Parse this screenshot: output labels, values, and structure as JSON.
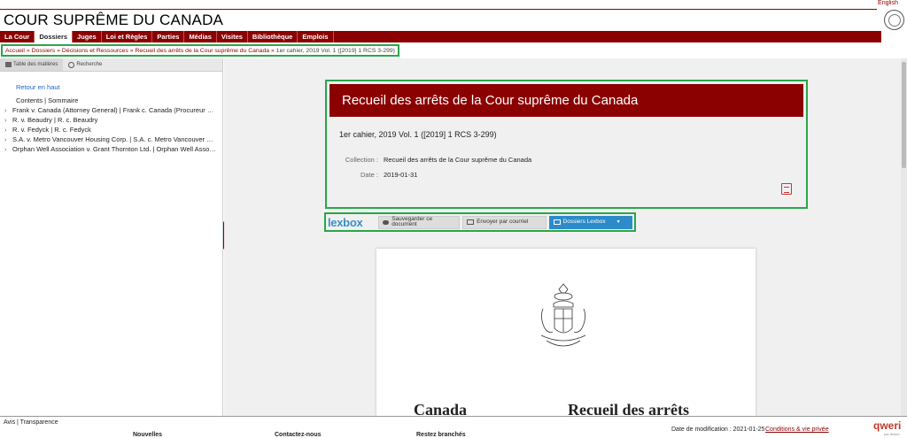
{
  "header": {
    "language_link": "English",
    "site_title": "COUR SUPRÊME DU CANADA"
  },
  "nav": {
    "items": [
      "La Cour",
      "Dossiers",
      "Juges",
      "Loi et Règles",
      "Parties",
      "Médias",
      "Visites",
      "Bibliothèque",
      "Emplois"
    ],
    "active": "Dossiers"
  },
  "breadcrumb": {
    "items": [
      "Accueil",
      "Dossiers",
      "Décisions et Ressources",
      "Recueil des arrêts de la Cour suprême du Canada"
    ],
    "current": "1er cahier, 2019 Vol. 1 ([2019] 1 RCS 3-299)"
  },
  "left_panel": {
    "tabs": [
      "Table des matières",
      "Recherche"
    ],
    "back_to_top": "Retour en haut",
    "toc": [
      "Contents | Sommaire",
      "Frank v. Canada (Attorney General) | Frank c. Canada (Procureur général)",
      "R. v. Beaudry | R. c. Beaudry",
      "R. v. Fedyck | R. c. Fedyck",
      "S.A. v. Metro Vancouver Housing Corp. | S.A. c. Metro Vancouver Housing Corp.",
      "Orphan Well Association v. Grant Thornton Ltd. | Orphan Well Association c. Grant Thornton Ltd."
    ]
  },
  "info_card": {
    "title": "Recueil des arrêts de la Cour suprême du Canada",
    "subtitle": "1er cahier, 2019 Vol. 1 ([2019] 1 RCS 3-299)",
    "collection_label": "Collection :",
    "collection_value": "Recueil des arrêts de la Cour suprême du Canada",
    "date_label": "Date :",
    "date_value": "2019-01-31"
  },
  "lexbox": {
    "logo": "lexbox",
    "save_label": "Sauvegarder ce document",
    "email_label": "Envoyer par courriel",
    "folders_label": "Dossiers Lexbox"
  },
  "document": {
    "left_heading": "Canada",
    "right_heading": "Recueil des arrêts"
  },
  "footer": {
    "links": "Avis | Transparence",
    "cols": [
      "Nouvelles",
      "Contactez-nous",
      "Restez branchés"
    ],
    "modified": "Date de modification : 2021-01-25",
    "conditions": "Conditions & vie privée",
    "brand": "qweri",
    "brand_sub": "par lexum"
  },
  "colors": {
    "brand_red": "#8b0000",
    "highlight_green": "#2aa64a",
    "lexbox_blue": "#2d8bc9"
  }
}
